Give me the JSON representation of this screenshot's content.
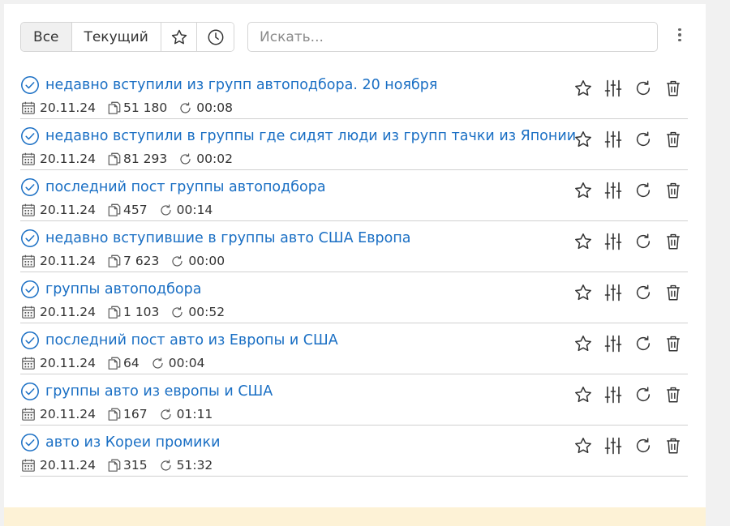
{
  "toolbar": {
    "tab_all": "Все",
    "tab_current": "Текущий",
    "search_placeholder": "Искать..."
  },
  "colors": {
    "link": "#1a6fc4",
    "text": "#333333",
    "divider": "#d0d0d0",
    "footer": "#fdf2d6"
  },
  "items": [
    {
      "title": "недавно вступили из групп автоподбора. 20 ноября",
      "date": "20.11.24",
      "count": "51 180",
      "duration": "00:08"
    },
    {
      "title": "недавно вступили в группы где сидят люди из групп тачки из Японии",
      "date": "20.11.24",
      "count": "81 293",
      "duration": "00:02"
    },
    {
      "title": "последний пост группы автоподбора",
      "date": "20.11.24",
      "count": "457",
      "duration": "00:14"
    },
    {
      "title": "недавно вступившие в группы авто США Европа",
      "date": "20.11.24",
      "count": "7 623",
      "duration": "00:00"
    },
    {
      "title": "группы автоподбора",
      "date": "20.11.24",
      "count": "1 103",
      "duration": "00:52"
    },
    {
      "title": "последний пост авто из Европы и США",
      "date": "20.11.24",
      "count": "64",
      "duration": "00:04"
    },
    {
      "title": "группы авто из европы и США",
      "date": "20.11.24",
      "count": "167",
      "duration": "01:11"
    },
    {
      "title": "авто из Кореи промики",
      "date": "20.11.24",
      "count": "315",
      "duration": "51:32"
    }
  ]
}
